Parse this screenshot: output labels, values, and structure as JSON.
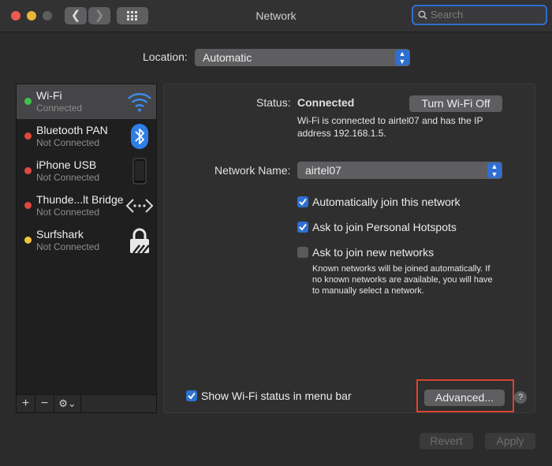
{
  "window": {
    "title": "Network"
  },
  "search": {
    "placeholder": "Search"
  },
  "location": {
    "label": "Location:",
    "value": "Automatic"
  },
  "sidebar": {
    "services": [
      {
        "name": "Wi-Fi",
        "status": "Connected",
        "dot": "#3fc24b",
        "icon": "wifi-icon"
      },
      {
        "name": "Bluetooth PAN",
        "status": "Not Connected",
        "dot": "#e0483e",
        "icon": "bluetooth-icon"
      },
      {
        "name": "iPhone USB",
        "status": "Not Connected",
        "dot": "#e0483e",
        "icon": "iphone-icon"
      },
      {
        "name": "Thunde...lt Bridge",
        "status": "Not Connected",
        "dot": "#e0483e",
        "icon": "thunderbolt-bridge-icon"
      },
      {
        "name": "Surfshark",
        "status": "Not Connected",
        "dot": "#f2c33c",
        "icon": "vpn-lock-icon"
      }
    ],
    "add_label": "+",
    "remove_label": "−",
    "actions_label": "⚙⌄"
  },
  "status": {
    "label": "Status:",
    "value": "Connected",
    "turn_off_label": "Turn Wi-Fi Off",
    "description_line1": "Wi-Fi is connected to airtel07 and has the IP",
    "description_line2": "address 192.168.1.5."
  },
  "network_name": {
    "label": "Network Name:",
    "value": "airtel07"
  },
  "options": [
    {
      "label": "Automatically join this network",
      "checked": true
    },
    {
      "label": "Ask to join Personal Hotspots",
      "checked": true
    },
    {
      "label": "Ask to join new networks",
      "checked": false
    }
  ],
  "note": {
    "line1": "Known networks will be joined automatically. If",
    "line2": "no known networks are available, you will have",
    "line3": "to manually select a network."
  },
  "menu_bar_option": {
    "label": "Show Wi-Fi status in menu bar",
    "checked": true
  },
  "buttons": {
    "advanced": "Advanced...",
    "help": "?",
    "revert": "Revert",
    "apply": "Apply"
  }
}
